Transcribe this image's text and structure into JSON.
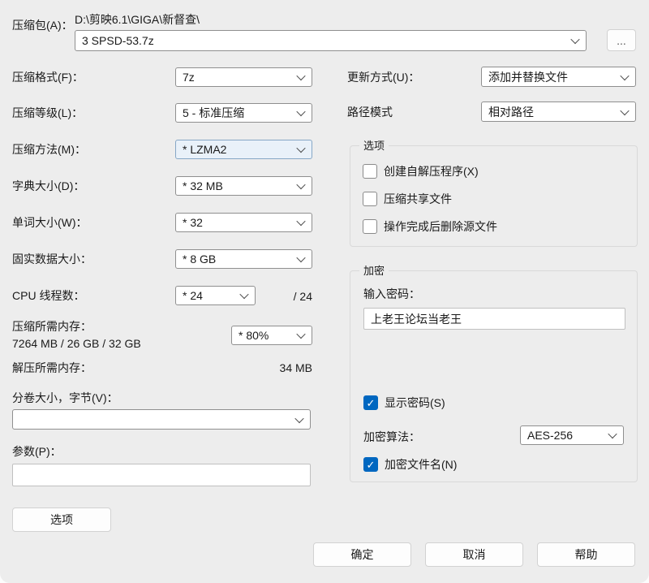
{
  "colors": {
    "accent": "#0067c0",
    "dialog_bg": "#ededed"
  },
  "archive": {
    "label": "压缩包(A)：",
    "dir_path": "D:\\剪映6.1\\GIGA\\新督查\\",
    "file_name": "3 SPSD-53.7z",
    "browse_label": "..."
  },
  "left": {
    "format": {
      "label": "压缩格式(F)：",
      "value": "7z"
    },
    "level": {
      "label": "压缩等级(L)：",
      "value": "5 - 标准压缩"
    },
    "method": {
      "label": "压缩方法(M)：",
      "value": "* LZMA2"
    },
    "dict": {
      "label": "字典大小(D)：",
      "value": "* 32 MB"
    },
    "word": {
      "label": "单词大小(W)：",
      "value": "* 32"
    },
    "solid": {
      "label": "固实数据大小：",
      "value": "* 8 GB"
    },
    "threads": {
      "label": "CPU 线程数：",
      "value": "* 24",
      "max": "/ 24"
    },
    "mem_compress": {
      "label": "压缩所需内存：",
      "detail": "7264 MB / 26 GB / 32 GB",
      "value": "* 80%"
    },
    "mem_decompress": {
      "label": "解压所需内存：",
      "value": "34 MB"
    },
    "volume": {
      "label": "分卷大小，字节(V)：",
      "value": ""
    },
    "params": {
      "label": "参数(P)：",
      "value": ""
    },
    "options_button": "选项"
  },
  "right": {
    "update_mode": {
      "label": "更新方式(U)：",
      "value": "添加并替换文件"
    },
    "path_mode": {
      "label": "路径模式",
      "value": "相对路径"
    },
    "options_group": {
      "title": "选项",
      "items": [
        {
          "label": "创建自解压程序(X)",
          "checked": false
        },
        {
          "label": "压缩共享文件",
          "checked": false
        },
        {
          "label": "操作完成后删除源文件",
          "checked": false
        }
      ]
    },
    "encryption_group": {
      "title": "加密",
      "password_label": "输入密码：",
      "password_value": "上老王论坛当老王",
      "show_password": {
        "label": "显示密码(S)",
        "checked": true
      },
      "method": {
        "label": "加密算法：",
        "value": "AES-256"
      },
      "encrypt_names": {
        "label": "加密文件名(N)",
        "checked": true
      }
    }
  },
  "footer": {
    "ok": "确定",
    "cancel": "取消",
    "help": "帮助"
  }
}
